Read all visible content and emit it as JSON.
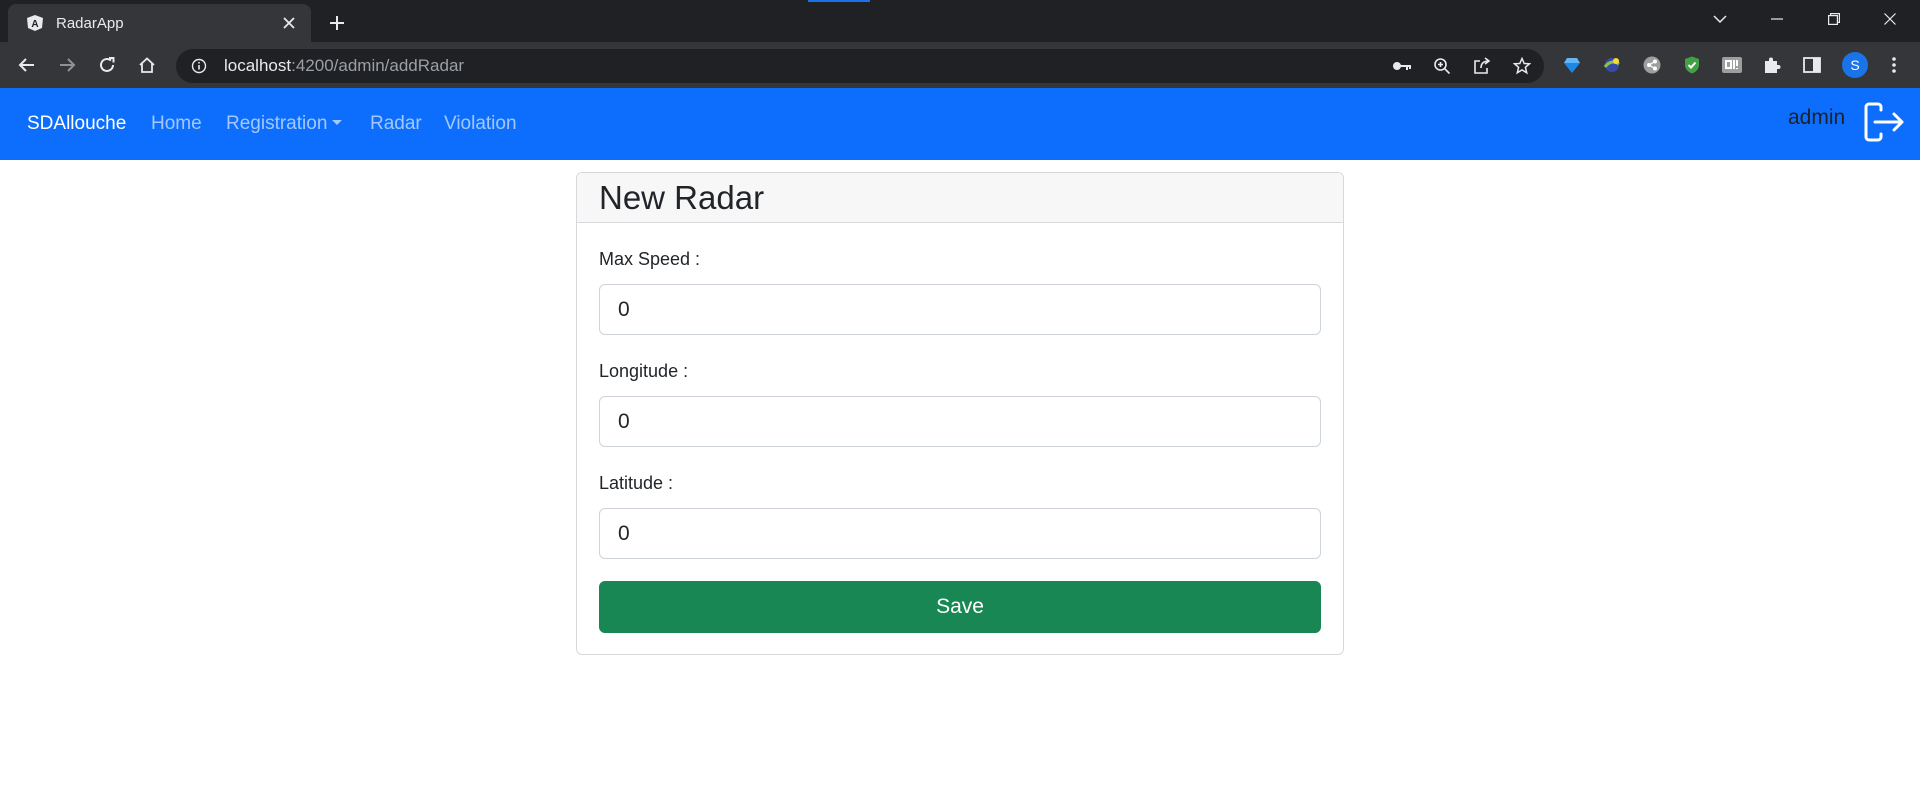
{
  "browser": {
    "tab_title": "RadarApp",
    "url_host": "localhost",
    "url_rest": ":4200/admin/addRadar",
    "profile_initial": "S"
  },
  "navbar": {
    "brand": "SDAllouche",
    "links": {
      "home": "Home",
      "registration": "Registration",
      "radar": "Radar",
      "violation": "Violation"
    },
    "user": "admin"
  },
  "form": {
    "title": "New Radar",
    "max_speed": {
      "label": "Max Speed :",
      "value": "0"
    },
    "longitude": {
      "label": "Longitude :",
      "value": "0"
    },
    "latitude": {
      "label": "Latitude :",
      "value": "0"
    },
    "save_label": "Save"
  },
  "colors": {
    "navbar": "#0d6efd",
    "save_button": "#198754",
    "browser_frame": "#202124"
  }
}
